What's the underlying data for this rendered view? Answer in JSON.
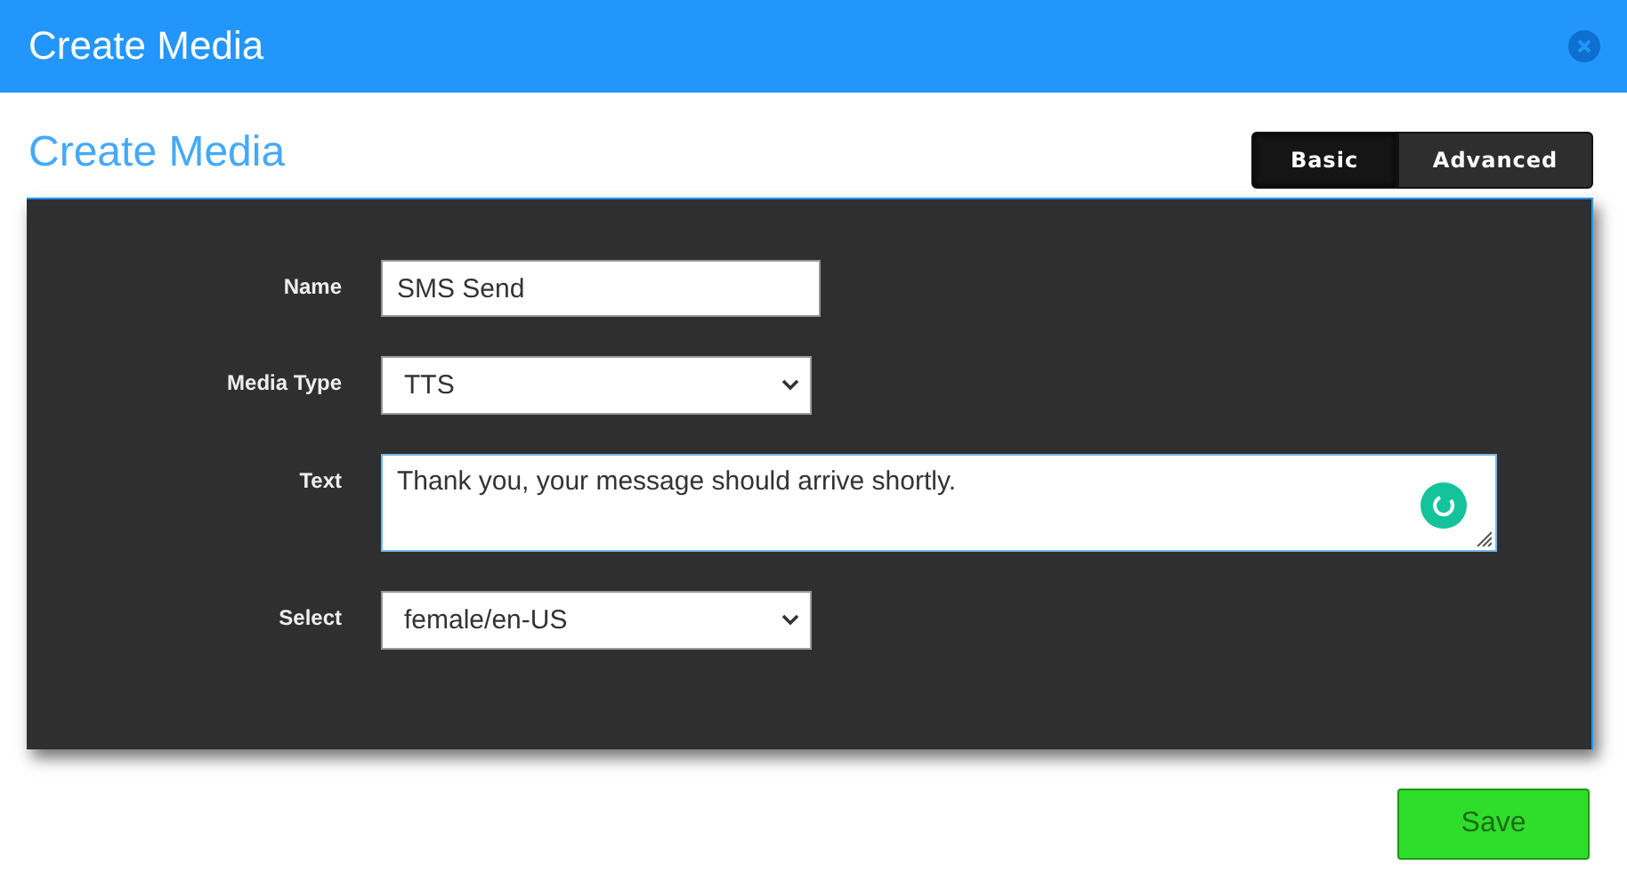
{
  "window": {
    "title": "Create Media"
  },
  "heading": "Create Media",
  "tabs": [
    {
      "label": "Basic",
      "selected": true
    },
    {
      "label": "Advanced",
      "selected": false
    }
  ],
  "fields": [
    {
      "kind": "input",
      "label": "Name",
      "value": "SMS Send"
    },
    {
      "kind": "select",
      "label": "Media Type",
      "value": "TTS"
    },
    {
      "kind": "textarea",
      "label": "Text",
      "value": "Thank you, your message should arrive shortly."
    },
    {
      "kind": "select",
      "label": "Select",
      "value": "female/en-US"
    }
  ],
  "buttons": [
    "Save"
  ]
}
